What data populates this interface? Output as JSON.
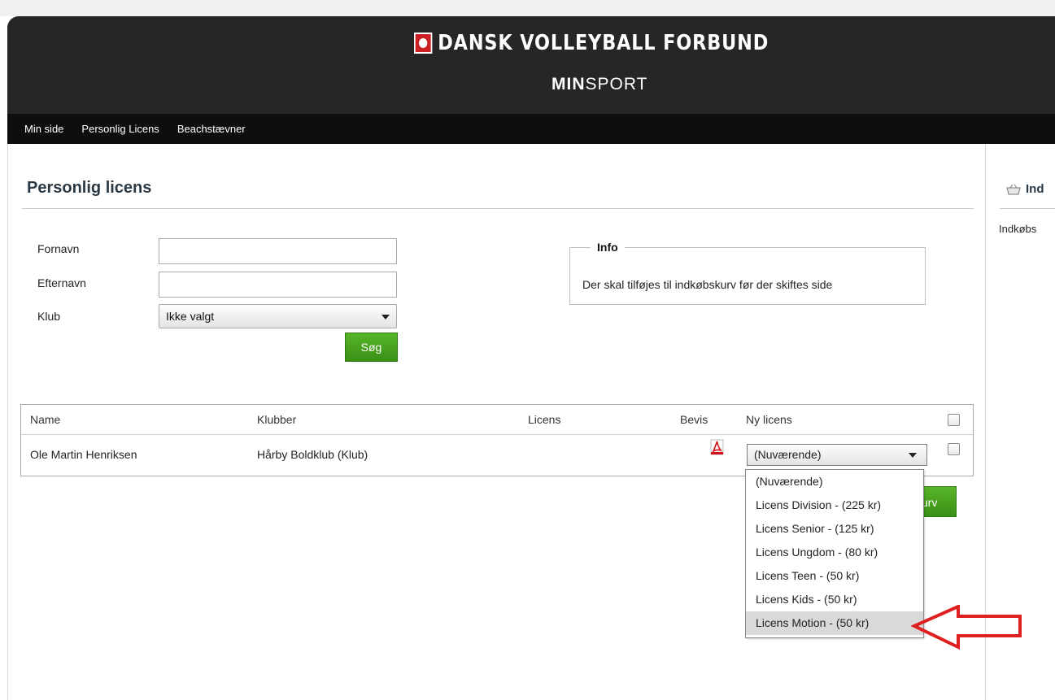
{
  "header": {
    "brand": "DANSK VOLLEYBALL FORBUND",
    "sub_bold": "MIN",
    "sub_light": "SPORT"
  },
  "nav": {
    "items": [
      {
        "label": "Min side"
      },
      {
        "label": "Personlig Licens"
      },
      {
        "label": "Beachstævner"
      }
    ]
  },
  "page": {
    "title": "Personlig licens"
  },
  "form": {
    "firstname_label": "Fornavn",
    "lastname_label": "Efternavn",
    "club_label": "Klub",
    "firstname_value": "",
    "lastname_value": "",
    "club_selected": "Ikke valgt",
    "search_button": "Søg"
  },
  "info": {
    "legend": "Info",
    "text": "Der skal tilføjes til indkøbskurv før der skiftes side"
  },
  "table": {
    "headers": [
      "Name",
      "Klubber",
      "Licens",
      "Bevis",
      "Ny licens"
    ],
    "rows": [
      {
        "name": "Ole Martin Henriksen",
        "club": "Hårby Boldklub (Klub)",
        "license": "",
        "new_license_selected": "(Nuværende)"
      }
    ]
  },
  "dropdown": {
    "options": [
      "(Nuværende)",
      "Licens Division - (225 kr)",
      "Licens Senior - (125 kr)",
      "Licens Ungdom - (80 kr)",
      "Licens Teen - (50 kr)",
      "Licens Kids - (50 kr)",
      "Licens Motion - (50 kr)"
    ],
    "highlighted": "Licens Motion - (50 kr)"
  },
  "cart_button": {
    "visible_text": "urv"
  },
  "sidebar": {
    "header": "Ind",
    "text": "Indkøbs"
  },
  "colors": {
    "header_bg": "#262626",
    "navbar_bg": "#0e0e0e",
    "button_green": "#3f9a1a",
    "annotation_red": "#e02020"
  }
}
